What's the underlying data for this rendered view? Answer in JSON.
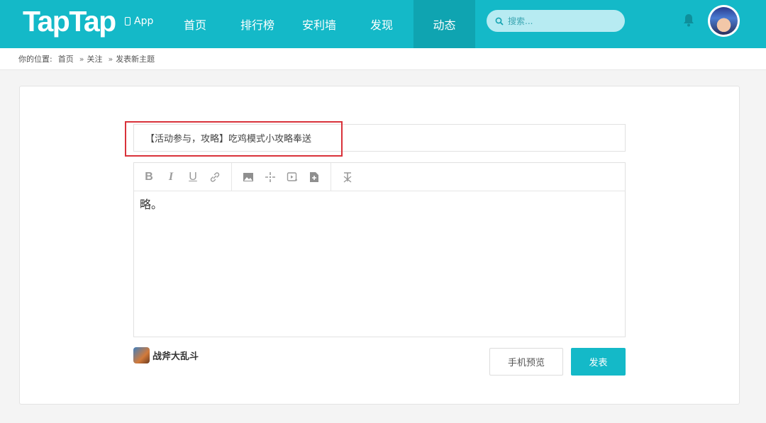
{
  "header": {
    "logo": "TapTap",
    "app_label": "App",
    "nav": [
      "首页",
      "排行榜",
      "安利墙",
      "发现",
      "动态"
    ],
    "active_nav": "动态",
    "search_placeholder": "搜索...",
    "accent_color": "#14b9c8"
  },
  "breadcrumb": {
    "prefix": "你的位置:",
    "items": [
      "首页",
      "关注",
      "发表新主题"
    ],
    "separator": "»"
  },
  "post": {
    "title": "【活动参与，攻略】吃鸡模式小攻略奉送",
    "body": "略。",
    "toolbar_icons": [
      "bold-icon",
      "italic-icon",
      "underline-icon",
      "link-icon",
      "image-icon",
      "move-icon",
      "video-icon",
      "add-file-icon",
      "clear-format-icon"
    ],
    "game_name": "战斧大乱斗",
    "preview_label": "手机预览",
    "submit_label": "发表"
  }
}
